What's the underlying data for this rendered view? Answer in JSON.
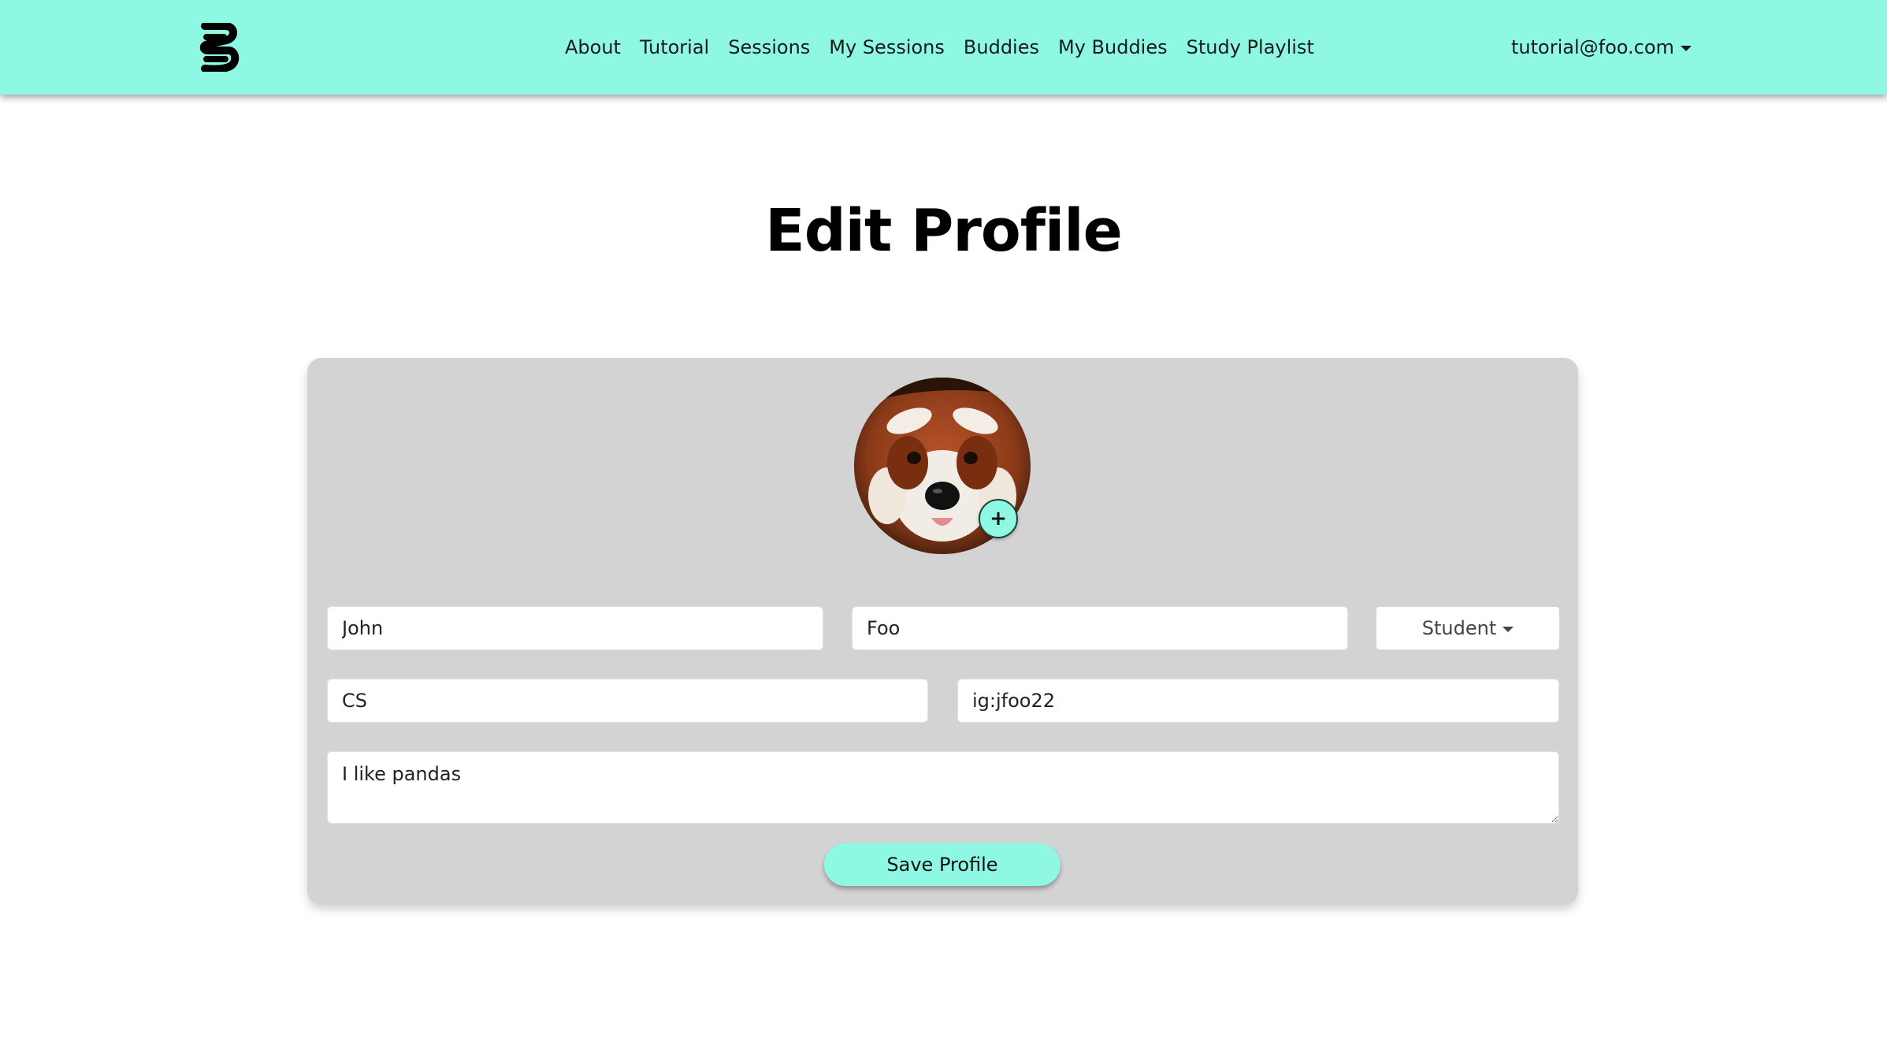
{
  "nav": {
    "logo_icon": "study-buddy-logo-icon",
    "links": [
      "About",
      "Tutorial",
      "Sessions",
      "My Sessions",
      "Buddies",
      "My Buddies",
      "Study Playlist"
    ],
    "user_email": "tutorial@foo.com"
  },
  "page": {
    "title": "Edit Profile"
  },
  "profile": {
    "avatar_icon": "red-panda-photo",
    "add_photo_label": "+",
    "first_name": "John",
    "last_name": "Foo",
    "role": "Student",
    "major": "CS",
    "social": "ig:jfoo22",
    "bio": "I like pandas",
    "save_label": "Save Profile"
  },
  "colors": {
    "accent": "#8ff8e2",
    "card_background": "#d3d3d3"
  }
}
